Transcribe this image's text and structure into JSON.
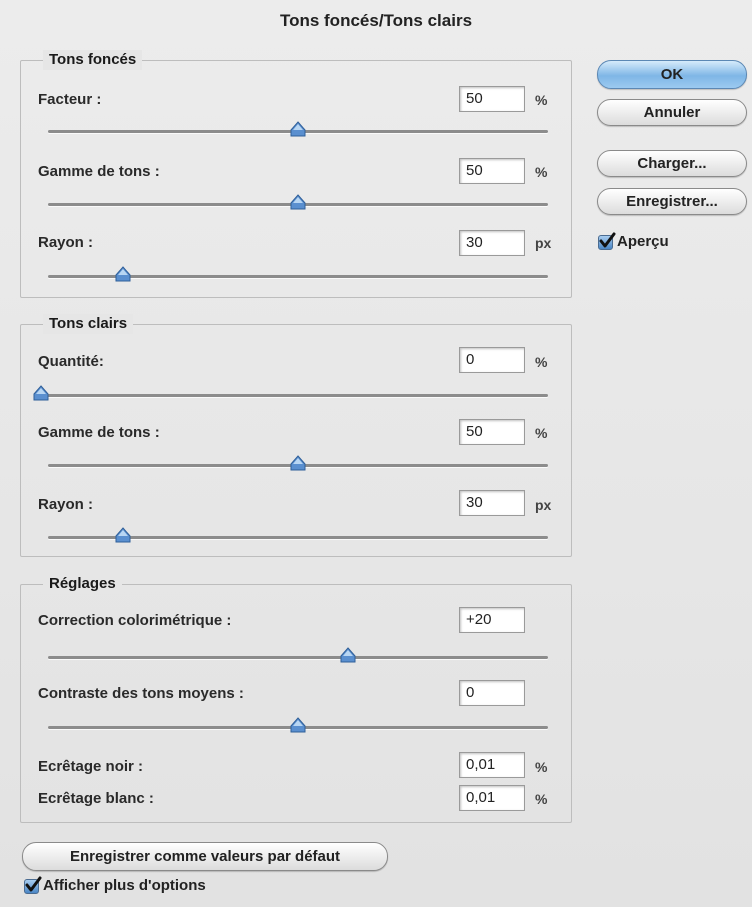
{
  "window": {
    "title": "Tons foncés/Tons clairs"
  },
  "shadows": {
    "legend": "Tons foncés",
    "amount": {
      "label": "Facteur :",
      "value": "50",
      "unit": "%",
      "slider_fraction": 0.5
    },
    "tonal_width": {
      "label": "Gamme de tons :",
      "value": "50",
      "unit": "%",
      "slider_fraction": 0.5
    },
    "radius": {
      "label": "Rayon :",
      "value": "30",
      "unit": "px",
      "slider_fraction": 0.15
    }
  },
  "highlights": {
    "legend": "Tons clairs",
    "amount": {
      "label": "Quantité:",
      "value": "0",
      "unit": "%",
      "slider_fraction": 0.0
    },
    "tonal_width": {
      "label": "Gamme de tons :",
      "value": "50",
      "unit": "%",
      "slider_fraction": 0.5
    },
    "radius": {
      "label": "Rayon :",
      "value": "30",
      "unit": "px",
      "slider_fraction": 0.15
    }
  },
  "adjustments": {
    "legend": "Réglages",
    "color_correction": {
      "label": "Correction colorimétrique :",
      "value": "+20",
      "slider_fraction": 0.6
    },
    "midtone_contrast": {
      "label": "Contraste des tons moyens :",
      "value": "0",
      "slider_fraction": 0.5
    },
    "black_clip": {
      "label": "Ecrêtage noir :",
      "value": "0,01",
      "unit": "%"
    },
    "white_clip": {
      "label": "Ecrêtage blanc :",
      "value": "0,01",
      "unit": "%"
    }
  },
  "buttons": {
    "ok": "OK",
    "cancel": "Annuler",
    "load": "Charger...",
    "save": "Enregistrer...",
    "save_defaults": "Enregistrer comme valeurs par défaut"
  },
  "checkboxes": {
    "preview": {
      "label": "Aperçu",
      "checked": true
    },
    "more_options": {
      "label": "Afficher plus d'options",
      "checked": true
    }
  },
  "colors": {
    "accent": "#7fb6e6",
    "thumb": "#5a8fcf"
  }
}
